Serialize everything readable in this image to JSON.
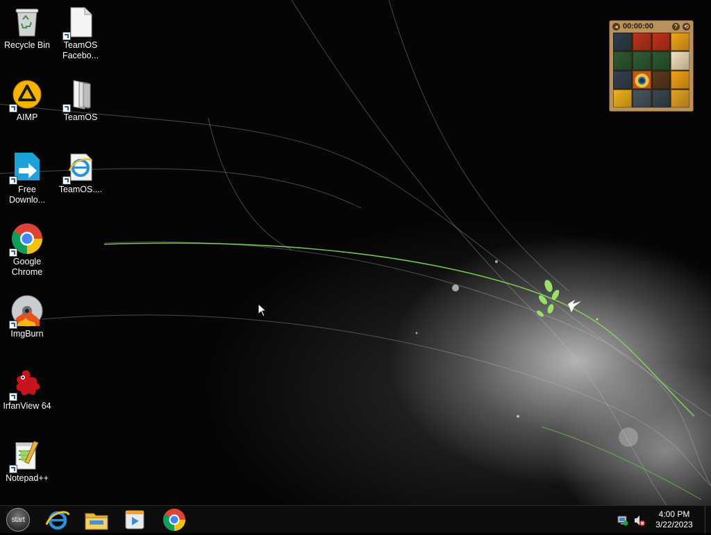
{
  "desktop": {
    "icons": [
      {
        "label": "Recycle Bin",
        "icon": "recycle-bin-icon",
        "shortcut": false
      },
      {
        "label": "TeamOS\nFacebo...",
        "icon": "document-icon",
        "shortcut": true
      },
      {
        "label": "AIMP",
        "icon": "aimp-icon",
        "shortcut": true
      },
      {
        "label": "TeamOS",
        "icon": "folder-icon",
        "shortcut": true
      },
      {
        "label": "Free\nDownlo...",
        "icon": "free-download-manager-icon",
        "shortcut": true
      },
      {
        "label": "TeamOS....",
        "icon": "internet-explorer-icon",
        "shortcut": true
      },
      {
        "label": "Google\nChrome",
        "icon": "chrome-icon",
        "shortcut": true
      },
      {
        "label": "ImgBurn",
        "icon": "imgburn-icon",
        "shortcut": true
      },
      {
        "label": "IrfanView 64",
        "icon": "irfanview-icon",
        "shortcut": true
      },
      {
        "label": "Notepad++",
        "icon": "notepad-plus-plus-icon",
        "shortcut": true
      }
    ]
  },
  "gadget": {
    "timer": "00:00:00",
    "help": "?",
    "tiles": [
      "#2f3e4a",
      "#b8351e",
      "#c0321b",
      "#f0a51a",
      "#2e5a34",
      "#2f5d36",
      "#2c5a31",
      "#f1e1b8",
      "#34424e",
      "eye",
      "#5b3a1c",
      "#f2a018",
      "#f0b21b",
      "#4a5560",
      "#3a4652",
      "#e5a221"
    ]
  },
  "taskbar": {
    "start_label": "start",
    "apps": [
      "internet-explorer-icon",
      "file-explorer-icon",
      "media-player-icon",
      "chrome-icon"
    ],
    "tray": {
      "time": "4:00 PM",
      "date": "3/22/2023"
    }
  },
  "colors": {
    "taskbar_bg": "#0d0d0d",
    "accent_green": "#7ed957"
  }
}
